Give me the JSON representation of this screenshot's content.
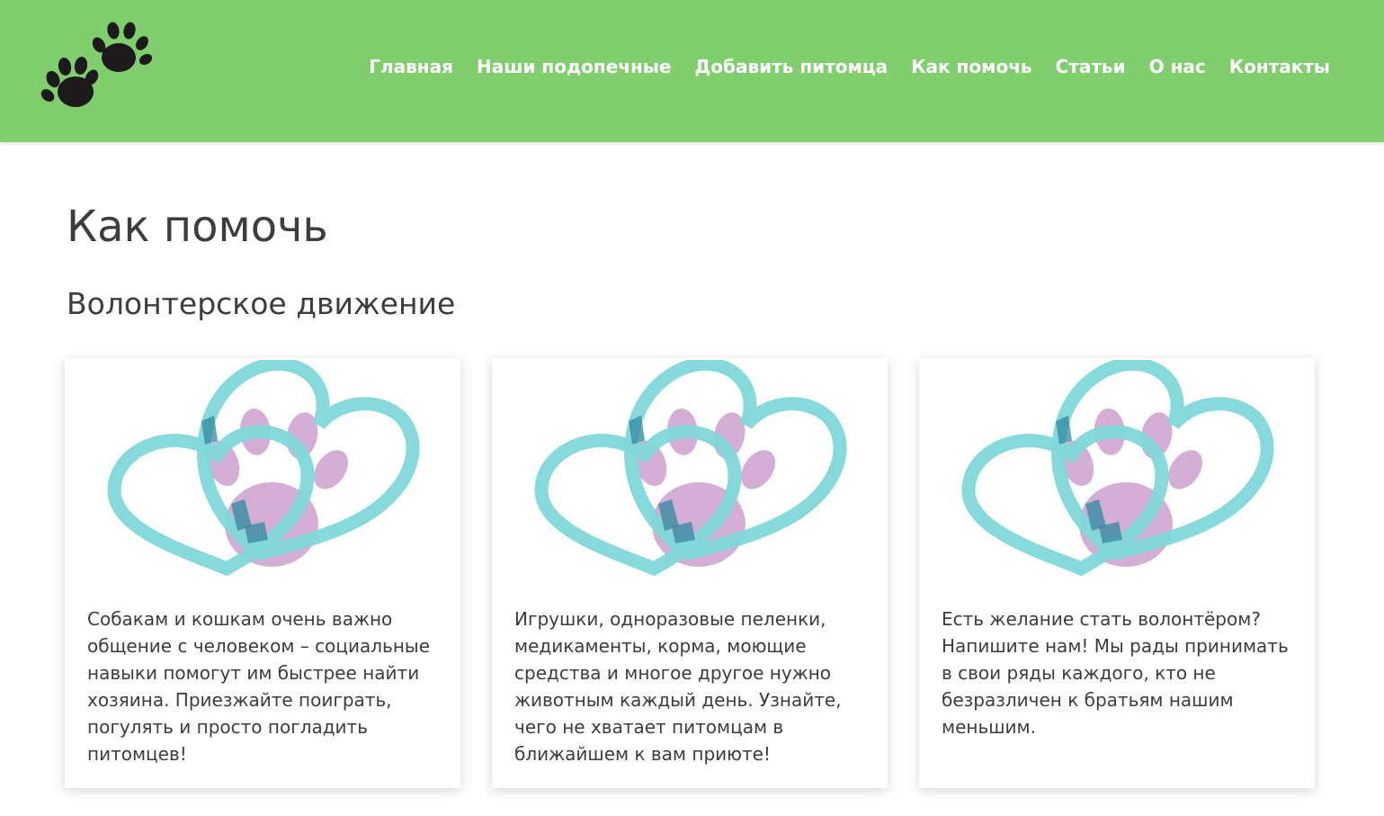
{
  "header": {
    "logo": "paw-prints-logo",
    "background_color": "#80ce6e",
    "nav": [
      {
        "label": "Главная"
      },
      {
        "label": "Наши подопечные"
      },
      {
        "label": "Добавить питомца"
      },
      {
        "label": "Как помочь"
      },
      {
        "label": "Статьи"
      },
      {
        "label": "О нас"
      },
      {
        "label": "Контакты"
      }
    ]
  },
  "main": {
    "title": "Как помочь",
    "section_title": "Волонтерское движение",
    "cards": [
      {
        "image": "hearts-paw-illustration",
        "text": "Собакам и кошкам очень важно общение с человеком – социальные навыки помогут им быстрее найти хозяина. Приезжайте поиграть, погулять и просто погладить питомцев!"
      },
      {
        "image": "hearts-paw-illustration",
        "text": "Игрушки, одноразовые пеленки, медикаменты, корма, моющие средства и многое другое нужно животным каждый день. Узнайте, чего не хватает питомцам в ближайшем к вам приюте!"
      },
      {
        "image": "hearts-paw-illustration",
        "text": "Есть желание стать волонтёром? Напишите нам! Мы рады принимать в свои ряды каждого, кто не безразличен к братьям нашим меньшим."
      }
    ]
  },
  "colors": {
    "heart": "#7fd8d9",
    "paw": "#d4aed4",
    "overlap": "#2f8aa0",
    "text": "#3d3d3d"
  }
}
